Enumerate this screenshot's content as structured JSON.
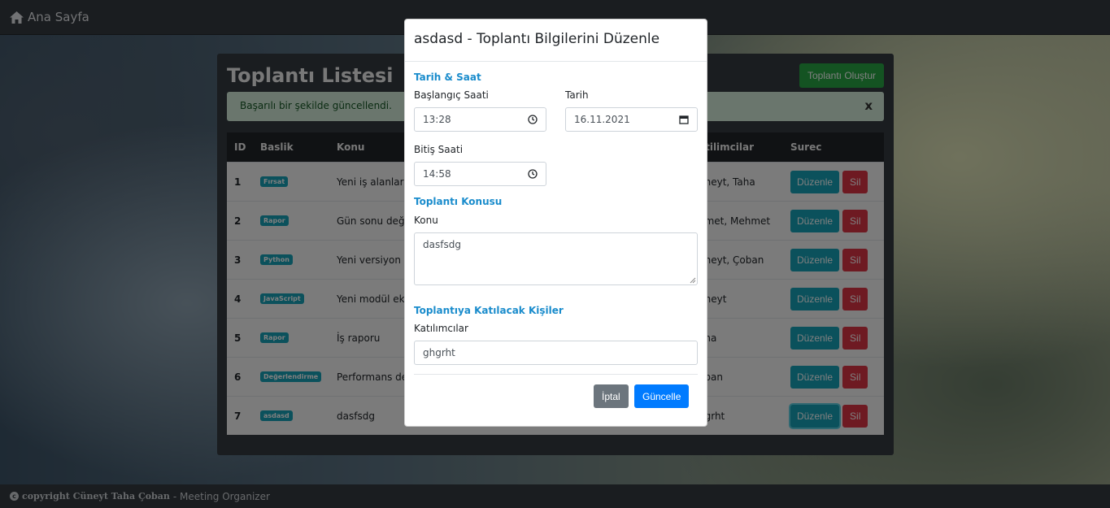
{
  "navbar": {
    "brand": "Ana Sayfa",
    "icon": "home-icon"
  },
  "panel": {
    "title": "Toplantı Listesi",
    "create_button": "Toplantı Oluştur",
    "alert": {
      "text": "Başarılı bir şekilde güncellendi.",
      "close": "x"
    }
  },
  "table": {
    "headers": {
      "id": "ID",
      "baslik": "Baslik",
      "konu": "Konu",
      "katilimcilar": "atilimcilar",
      "surec": "Surec"
    },
    "rows": [
      {
        "id": "1",
        "badge": "Fırsat",
        "konu": "Yeni iş alanların",
        "katilimcilar": "üneyt, Taha"
      },
      {
        "id": "2",
        "badge": "Rapor",
        "konu": "Gün sonu değer",
        "katilimcilar": "hmet, Mehmet"
      },
      {
        "id": "3",
        "badge": "Python",
        "konu": "Yeni versiyon ge",
        "katilimcilar": "üneyt, Çoban"
      },
      {
        "id": "4",
        "badge": "JavaScript",
        "konu": "Yeni modül ekle",
        "katilimcilar": "üneyt"
      },
      {
        "id": "5",
        "badge": "Rapor",
        "konu": "İş raporu",
        "katilimcilar": "aha"
      },
      {
        "id": "6",
        "badge": "Değerlendirme",
        "konu": "Performans değ",
        "katilimcilar": "oban"
      },
      {
        "id": "7",
        "badge": "asdasd",
        "konu": "dasfsdg",
        "katilimcilar": "hgrht"
      }
    ],
    "edit_label": "Düzenle",
    "delete_label": "Sil"
  },
  "footer": {
    "copyright": "copyright Cüneyt Taha Çoban",
    "suffix": "- Meeting Organizer"
  },
  "modal": {
    "title": "asdasd - Toplantı Bilgilerini Düzenle",
    "section_datetime": "Tarih & Saat",
    "start_label": "Başlangıç Saati",
    "start_value": "13:28",
    "date_label": "Tarih",
    "date_value": "16.11.2021",
    "end_label": "Bitiş Saati",
    "end_value": "14:58",
    "section_topic": "Toplantı Konusu",
    "topic_label": "Konu",
    "topic_value": "dasfsdg",
    "section_people": "Toplantıya Katılacak Kişiler",
    "people_label": "Katılımcılar",
    "people_value": "ghgrht",
    "cancel_label": "İptal",
    "update_label": "Güncelle"
  },
  "colors": {
    "section": "#1a8ccc",
    "primary": "#007bff",
    "success": "#28a745",
    "info": "#17a2b8",
    "danger": "#dc3545"
  }
}
